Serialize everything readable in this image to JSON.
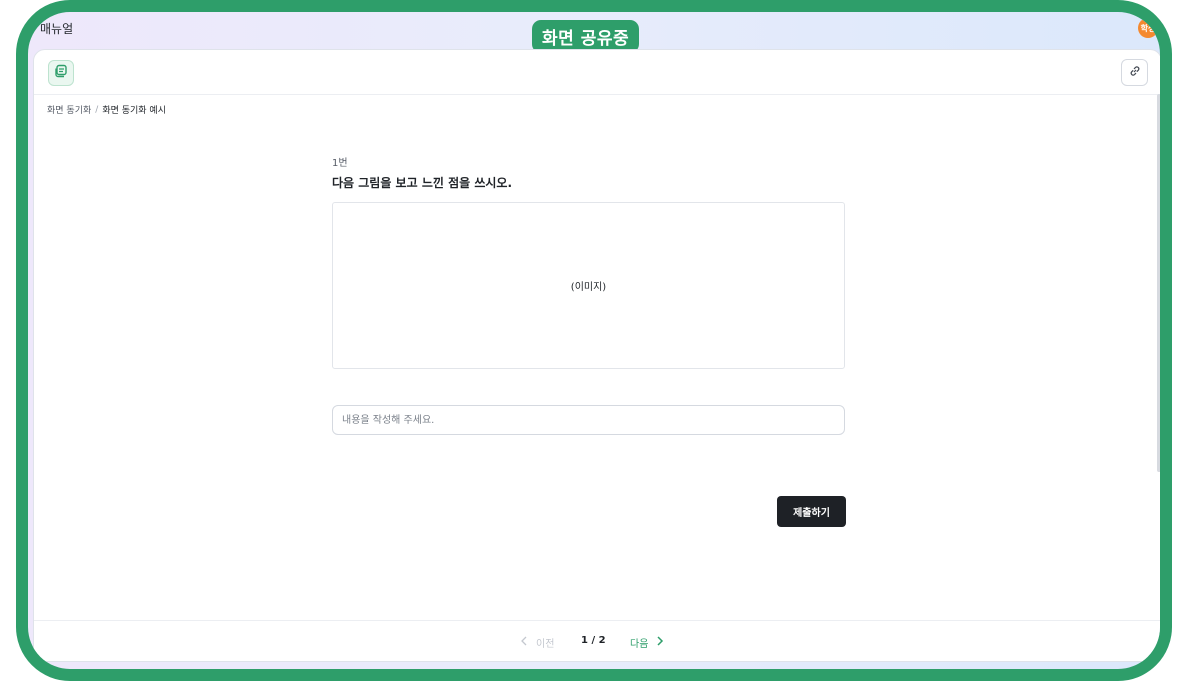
{
  "window": {
    "app_title": "매뉴얼",
    "share_status": "화면 공유중",
    "user_badge": "학생"
  },
  "breadcrumb": {
    "items": [
      "화면 동기화",
      "화면 동기화 예시"
    ],
    "separator": "/"
  },
  "question": {
    "number": "1번",
    "text": "다음 그림을 보고 느낀 점을 쓰시오.",
    "image_placeholder": "(이미지)"
  },
  "answer": {
    "placeholder": "내용을 작성해 주세요.",
    "value": ""
  },
  "actions": {
    "submit_label": "제출하기"
  },
  "pagination": {
    "prev_label": "이전",
    "page_text": "1 / 2",
    "next_label": "다음"
  },
  "colors": {
    "accent": "#2e9e6a",
    "submit_bg": "#1e2126",
    "avatar": "#f4892f"
  },
  "icons": {
    "logo": "note-stack-icon",
    "link": "link-icon",
    "prev": "chevron-left-icon",
    "next": "chevron-right-icon"
  }
}
